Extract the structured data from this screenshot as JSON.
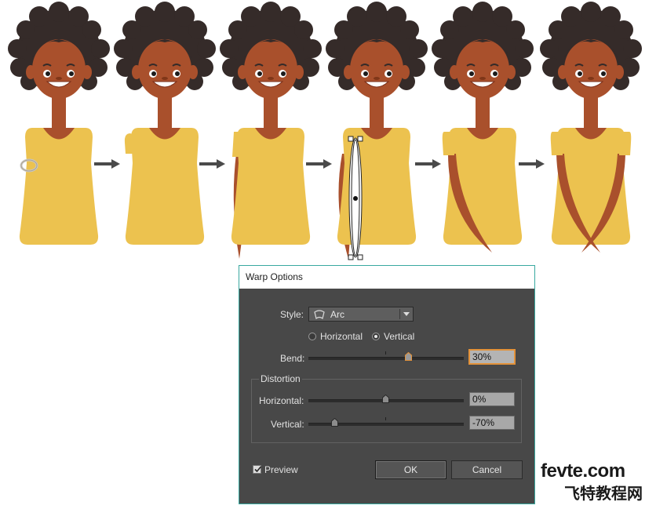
{
  "dialog": {
    "title": "Warp Options",
    "style_label": "Style:",
    "style_value": "Arc",
    "orientation": {
      "horizontal_label": "Horizontal",
      "vertical_label": "Vertical",
      "selected": "Vertical"
    },
    "bend": {
      "label": "Bend:",
      "value": "30%",
      "level_percent": 30
    },
    "distortion": {
      "title": "Distortion",
      "horizontal": {
        "label": "Horizontal:",
        "value": "0%",
        "level_percent": 0
      },
      "vertical": {
        "label": "Vertical:",
        "value": "-70%",
        "level_percent": -70
      }
    },
    "preview": {
      "label": "Preview",
      "checked": true
    },
    "ok_label": "OK",
    "cancel_label": "Cancel"
  },
  "watermark": {
    "line1": "fevte.com",
    "line2": "飞特教程网"
  },
  "colors": {
    "hair": "#352b29",
    "skin": "#a9502c",
    "dress": "#ecc24f",
    "dialog_bg": "#484848",
    "dialog_border": "#39a9a0",
    "focus": "#e3923a"
  }
}
